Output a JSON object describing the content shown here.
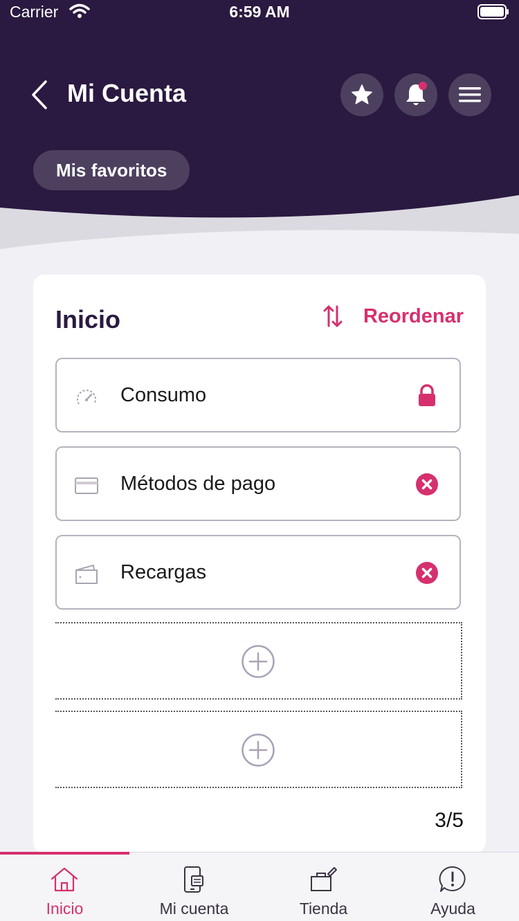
{
  "status_bar": {
    "carrier": "Carrier",
    "time": "6:59 AM"
  },
  "header": {
    "title": "Mi Cuenta",
    "chip_label": "Mis favoritos",
    "colors": {
      "background": "#2a1940",
      "button": "#4d405f",
      "notification_dot": "#d6306e"
    },
    "icons": [
      "back-icon",
      "star-icon",
      "bell-icon",
      "menu-icon"
    ]
  },
  "card": {
    "title": "Inicio",
    "reorder_label": "Reordenar",
    "items": [
      {
        "label": "Consumo",
        "icon": "speedometer-icon",
        "action": "lock-icon"
      },
      {
        "label": "Métodos de pago",
        "icon": "card-icon",
        "action": "remove-icon"
      },
      {
        "label": "Recargas",
        "icon": "wallet-icon",
        "action": "remove-icon"
      }
    ],
    "counter": "3/5"
  },
  "tabbar": {
    "tabs": [
      {
        "label": "Inicio",
        "icon": "home-icon",
        "active": true
      },
      {
        "label": "Mi cuenta",
        "icon": "phone-account-icon",
        "active": false
      },
      {
        "label": "Tienda",
        "icon": "store-icon",
        "active": false
      },
      {
        "label": "Ayuda",
        "icon": "help-icon",
        "active": false
      }
    ]
  },
  "accent_color": "#d6306e"
}
